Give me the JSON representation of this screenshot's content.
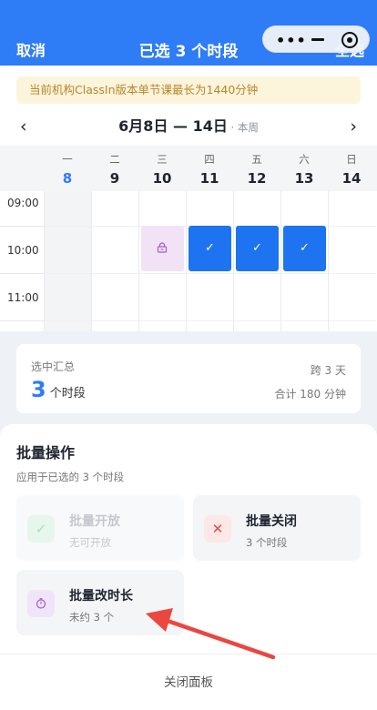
{
  "header": {
    "cancel": "取消",
    "title": "已选 3 个时段",
    "select_all": "全选"
  },
  "capsule": {
    "menu": "•••"
  },
  "notice": "当前机构ClassIn版本单节课最长为1440分钟",
  "week": {
    "prev": "‹",
    "next": "›",
    "range": "6月8日 — 14日",
    "sub": " · 本周"
  },
  "days": [
    {
      "w": "一",
      "d": "8"
    },
    {
      "w": "二",
      "d": "9"
    },
    {
      "w": "三",
      "d": "10"
    },
    {
      "w": "四",
      "d": "11"
    },
    {
      "w": "五",
      "d": "12"
    },
    {
      "w": "六",
      "d": "13"
    },
    {
      "w": "日",
      "d": "14"
    }
  ],
  "times": [
    "09:00",
    "10:00",
    "11:00"
  ],
  "check": "✓",
  "summary": {
    "label": "选中汇总",
    "count": "3",
    "unit": "个时段",
    "span": "跨 3 天",
    "total": "合计 180 分钟"
  },
  "batch": {
    "title": "批量操作",
    "subtitle": "应用于已选的 3 个时段",
    "open": {
      "icon": "✓",
      "title": "批量开放",
      "desc": "无可开放"
    },
    "close": {
      "icon": "✕",
      "title": "批量关闭",
      "desc": "3 个时段"
    },
    "duration": {
      "title": "批量改时长",
      "desc": "未约 3 个"
    },
    "close_panel": "关闭面板"
  },
  "colors": {
    "primary": "#2e7cf6",
    "selected": "#1e74f0",
    "locked": "#f1e2f6",
    "warning_bg": "#fdf4dc",
    "annotation": "#e9473f"
  }
}
